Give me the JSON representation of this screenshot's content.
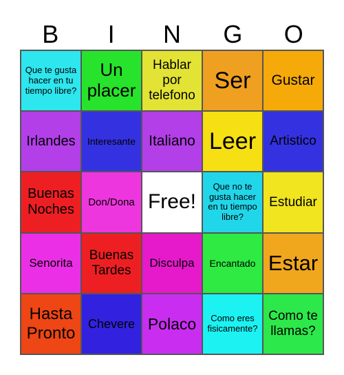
{
  "title_letters": [
    "B",
    "I",
    "N",
    "G",
    "O"
  ],
  "cells": [
    {
      "text": "Que te gusta hacer en tu tiempo libre?",
      "color": "#2EE6EE",
      "size": 13
    },
    {
      "text": "Un placer",
      "color": "#27E32B",
      "size": 26
    },
    {
      "text": "Hablar por telefono",
      "color": "#E3E336",
      "size": 19
    },
    {
      "text": "Ser",
      "color": "#EFA020",
      "size": 34
    },
    {
      "text": "Gustar",
      "color": "#F5AA0A",
      "size": 21
    },
    {
      "text": "Irlandes",
      "color": "#B23FE8",
      "size": 20
    },
    {
      "text": "Interesante",
      "color": "#3432E0",
      "size": 14
    },
    {
      "text": "Italiano",
      "color": "#B23FE8",
      "size": 21
    },
    {
      "text": "Leer",
      "color": "#F6DF12",
      "size": 34
    },
    {
      "text": "Artistico",
      "color": "#3432E0",
      "size": 19
    },
    {
      "text": "Buenas Noches",
      "color": "#EE1F23",
      "size": 20
    },
    {
      "text": "Don/Dona",
      "color": "#EE36DE",
      "size": 15
    },
    {
      "text": "Free!",
      "color": "#FFFFFF",
      "size": 30
    },
    {
      "text": "Que no te gusta hacer en tu tiempo libre?",
      "color": "#22D6EA",
      "size": 13
    },
    {
      "text": "Estudiar",
      "color": "#F0E51E",
      "size": 19
    },
    {
      "text": "Senorita",
      "color": "#EB2FE6",
      "size": 17
    },
    {
      "text": "Buenas Tardes",
      "color": "#EE1F23",
      "size": 19
    },
    {
      "text": "Disculpa",
      "color": "#E61ACB",
      "size": 17
    },
    {
      "text": "Encantado",
      "color": "#2EEA42",
      "size": 14
    },
    {
      "text": "Estar",
      "color": "#F0A71E",
      "size": 31
    },
    {
      "text": "Hasta Pronto",
      "color": "#EE4614",
      "size": 24
    },
    {
      "text": "Chevere",
      "color": "#3222E0",
      "size": 18
    },
    {
      "text": "Polaco",
      "color": "#C92EF0",
      "size": 23
    },
    {
      "text": "Como eres fisicamente?",
      "color": "#1CF2F2",
      "size": 13
    },
    {
      "text": "Como te llamas?",
      "color": "#2DE84A",
      "size": 19
    }
  ]
}
